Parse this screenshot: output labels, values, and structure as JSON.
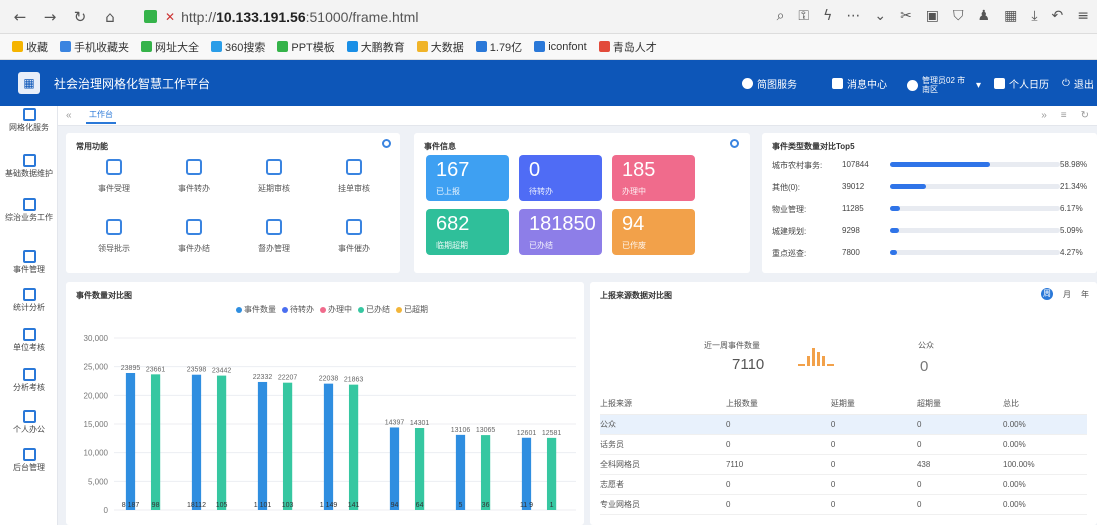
{
  "browser": {
    "url_prefix": "http://",
    "url_host": "10.133.191.56",
    "url_rest": ":51000/frame.html",
    "bookmarks": [
      {
        "label": "收藏",
        "color": "#f5b400"
      },
      {
        "label": "手机收藏夹",
        "color": "#3a84e0"
      },
      {
        "label": "网址大全",
        "color": "#35b34a"
      },
      {
        "label": "360搜索",
        "color": "#2a9de8"
      },
      {
        "label": "PPT模板",
        "color": "#35b34a"
      },
      {
        "label": "大鹏教育",
        "color": "#1a8fe6"
      },
      {
        "label": "大数据",
        "color": "#f0b429"
      },
      {
        "label": "1.79亿",
        "color": "#2a78d8"
      },
      {
        "label": "iconfont",
        "color": "#2a78d8"
      },
      {
        "label": "青岛人才",
        "color": "#e24b3b"
      }
    ]
  },
  "header": {
    "title": "社会治理网格化智慧工作平台",
    "items": [
      "简图服务",
      "消息中心",
      "管理员02 市南区",
      "个人日历",
      "退出"
    ]
  },
  "sidebar": {
    "items": [
      "网格化服务",
      "基础数据维护",
      "综治业务工作",
      "事件管理",
      "统计分析",
      "单位考核",
      "分析考核",
      "个人办公",
      "后台管理"
    ]
  },
  "tabs": {
    "current": "工作台"
  },
  "common": {
    "title": "常用功能",
    "items": [
      "事件受理",
      "事件转办",
      "延期审核",
      "挂单审核",
      "领导批示",
      "事件办结",
      "督办管理",
      "事件催办"
    ]
  },
  "event_info": {
    "title": "事件信息",
    "tiles": [
      {
        "value": "167",
        "label": "已上报",
        "color": "#3ea0f2"
      },
      {
        "value": "0",
        "label": "待转办",
        "color": "#4f6cf5"
      },
      {
        "value": "185",
        "label": "办理中",
        "color": "#f06b8c"
      },
      {
        "value": "682",
        "label": "临期超期",
        "color": "#2fbf9a"
      },
      {
        "value": "181850",
        "label": "已办结",
        "color": "#8d7ee8"
      },
      {
        "value": "94",
        "label": "已作废",
        "color": "#f2a14a"
      }
    ]
  },
  "top5": {
    "title": "事件类型数量对比Top5",
    "rows": [
      {
        "name": "城市农村事务:",
        "count": "107844",
        "pct": "58.98%",
        "ratio": 0.5898
      },
      {
        "name": "其他(0):",
        "count": "39012",
        "pct": "21.34%",
        "ratio": 0.2134
      },
      {
        "name": "物业管理:",
        "count": "11285",
        "pct": "6.17%",
        "ratio": 0.0617
      },
      {
        "name": "城建规划:",
        "count": "9298",
        "pct": "5.09%",
        "ratio": 0.0509
      },
      {
        "name": "重点巡查:",
        "count": "7800",
        "pct": "4.27%",
        "ratio": 0.0427
      }
    ]
  },
  "bar_panel": {
    "title": "事件数量对比图"
  },
  "source": {
    "title": "上报来源数据对比图",
    "toggle": [
      "周",
      "月",
      "年"
    ],
    "week_label": "近一周事件数量",
    "week_value": "7110",
    "public_label": "公众",
    "public_value": "0",
    "headers": [
      "上报来源",
      "上报数量",
      "延期量",
      "超期量",
      "总比"
    ],
    "rows": [
      [
        "公众",
        "0",
        "0",
        "0",
        "0.00%"
      ],
      [
        "话务员",
        "0",
        "0",
        "0",
        "0.00%"
      ],
      [
        "全科网格员",
        "7110",
        "0",
        "438",
        "100.00%"
      ],
      [
        "志愿者",
        "0",
        "0",
        "0",
        "0.00%"
      ],
      [
        "专业网格员",
        "0",
        "0",
        "0",
        "0.00%"
      ]
    ]
  },
  "chart_data": {
    "type": "bar",
    "title": "事件数量对比图",
    "ylim": [
      0,
      30000
    ],
    "yticks": [
      "0",
      "5,000",
      "10,000",
      "15,000",
      "20,000",
      "25,000",
      "30,000"
    ],
    "series": [
      {
        "name": "事件数量",
        "color": "#2f8ee0",
        "values": [
          23895,
          23598,
          22332,
          22038,
          14397,
          13106,
          12601
        ],
        "labels": [
          "23895",
          "23598",
          "22332",
          "22038",
          "14397",
          "13106",
          "12601"
        ]
      },
      {
        "name": "待转办",
        "color": "#4a6ef0",
        "values": [
          0,
          0,
          0,
          0,
          0,
          0,
          0
        ],
        "labels": [
          "",
          "",
          "",
          "",
          "",
          "",
          ""
        ]
      },
      {
        "name": "办理中",
        "color": "#f06b8c",
        "values": [
          0,
          0,
          0,
          0,
          0,
          0,
          0
        ],
        "labels": [
          "",
          "",
          "",
          "",
          "",
          "",
          ""
        ]
      },
      {
        "name": "已办结",
        "color": "#36c7a1",
        "values": [
          23661,
          23442,
          22207,
          21863,
          14301,
          13065,
          12581
        ],
        "labels": [
          "23661",
          "23442",
          "22207",
          "21863",
          "14301",
          "13065",
          "12581"
        ]
      },
      {
        "name": "已超期",
        "color": "#f2b53a",
        "values": [
          0,
          0,
          0,
          0,
          0,
          0,
          0
        ],
        "labels": [
          "",
          "",
          "",
          "",
          "",
          "",
          ""
        ]
      }
    ],
    "bottom_labels": [
      "8 187",
      "98",
      "18112",
      "105",
      "1 101",
      "103",
      "1 149",
      "141",
      "94",
      "64",
      "5",
      "36",
      "11 9",
      "1"
    ],
    "grid": true,
    "legend": "top"
  }
}
